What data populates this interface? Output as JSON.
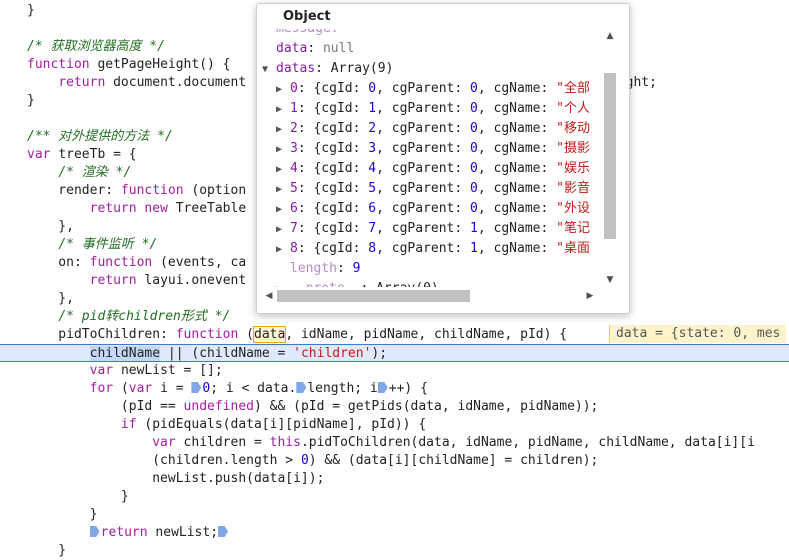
{
  "code_lines": [
    {
      "tokens": [
        {
          "t": "}"
        }
      ]
    },
    {
      "tokens": [
        {
          "t": ""
        }
      ]
    },
    {
      "tokens": [
        {
          "t": "/* 获取浏览器高度 */",
          "c": "c"
        }
      ]
    },
    {
      "tokens": [
        {
          "t": "function ",
          "c": "k"
        },
        {
          "t": "getPageHeight() {"
        }
      ]
    },
    {
      "tokens": [
        {
          "t": "    "
        },
        {
          "t": "return ",
          "c": "k"
        },
        {
          "t": "document.document"
        }
      ]
    },
    {
      "tokens": [
        {
          "t": "}"
        }
      ]
    },
    {
      "tokens": [
        {
          "t": ""
        }
      ]
    },
    {
      "tokens": [
        {
          "t": "/** 对外提供的方法 */",
          "c": "c"
        }
      ]
    },
    {
      "tokens": [
        {
          "t": "var ",
          "c": "k"
        },
        {
          "t": "treeTb = {"
        }
      ]
    },
    {
      "tokens": [
        {
          "t": "    "
        },
        {
          "t": "/* 渲染 */",
          "c": "c"
        }
      ]
    },
    {
      "tokens": [
        {
          "t": "    render: "
        },
        {
          "t": "function ",
          "c": "k"
        },
        {
          "t": "(option"
        }
      ]
    },
    {
      "tokens": [
        {
          "t": "        "
        },
        {
          "t": "return new ",
          "c": "k"
        },
        {
          "t": "TreeTable"
        }
      ]
    },
    {
      "tokens": [
        {
          "t": "    },"
        }
      ]
    },
    {
      "tokens": [
        {
          "t": "    "
        },
        {
          "t": "/* 事件监听 */",
          "c": "c"
        }
      ]
    },
    {
      "tokens": [
        {
          "t": "    on: "
        },
        {
          "t": "function ",
          "c": "k"
        },
        {
          "t": "(events, ca"
        }
      ]
    },
    {
      "tokens": [
        {
          "t": "        "
        },
        {
          "t": "return ",
          "c": "k"
        },
        {
          "t": "layui.onevent"
        }
      ]
    },
    {
      "tokens": [
        {
          "t": "    },"
        }
      ]
    },
    {
      "tokens": [
        {
          "t": "    "
        },
        {
          "t": "/* pid转children形式 */",
          "c": "c"
        }
      ]
    },
    {
      "tokens": [
        {
          "t": "    pidToChildren: "
        },
        {
          "t": "function ",
          "c": "k"
        },
        {
          "t": "("
        },
        {
          "t": "data",
          "c": "hl-box"
        },
        {
          "t": ", idName, pidName, childName, pId) {"
        }
      ]
    },
    {
      "current": true,
      "tokens": [
        {
          "t": "        "
        },
        {
          "t": "childName",
          "c": "hl-sel"
        },
        {
          "t": " || (childName = "
        },
        {
          "t": "'children'",
          "c": "s"
        },
        {
          "t": ");"
        }
      ]
    },
    {
      "tokens": [
        {
          "t": "        "
        },
        {
          "t": "var ",
          "c": "k"
        },
        {
          "t": "newList = [];"
        }
      ]
    },
    {
      "tokens": [
        {
          "t": "        "
        },
        {
          "t": "for ",
          "c": "k"
        },
        {
          "t": "("
        },
        {
          "t": "var ",
          "c": "k"
        },
        {
          "t": "i = "
        },
        {
          "t": "",
          "c": "bp"
        },
        {
          "t": "0",
          "c": "n"
        },
        {
          "t": "; i < data."
        },
        {
          "t": "",
          "c": "bp"
        },
        {
          "t": "length; i"
        },
        {
          "t": "",
          "c": "bp"
        },
        {
          "t": "++) {"
        }
      ]
    },
    {
      "tokens": [
        {
          "t": "            (pId == "
        },
        {
          "t": "undefined",
          "c": "k"
        },
        {
          "t": ") && (pId = getPids(data, idName, pidName));"
        }
      ]
    },
    {
      "tokens": [
        {
          "t": "            "
        },
        {
          "t": "if ",
          "c": "k"
        },
        {
          "t": "(pidEquals(data[i][pidName], pId)) {"
        }
      ]
    },
    {
      "tokens": [
        {
          "t": "                "
        },
        {
          "t": "var ",
          "c": "k"
        },
        {
          "t": "children = "
        },
        {
          "t": "this",
          "c": "k"
        },
        {
          "t": ".pidToChildren(data, idName, pidName, childName, data[i][i"
        }
      ]
    },
    {
      "tokens": [
        {
          "t": "                (children.length > "
        },
        {
          "t": "0",
          "c": "n"
        },
        {
          "t": ") && (data[i][childName] = children);"
        }
      ]
    },
    {
      "tokens": [
        {
          "t": "                newList.push(data[i]);"
        }
      ]
    },
    {
      "tokens": [
        {
          "t": "            }"
        }
      ]
    },
    {
      "tokens": [
        {
          "t": "        }"
        }
      ]
    },
    {
      "tokens": [
        {
          "t": "        "
        },
        {
          "t": "",
          "c": "bp"
        },
        {
          "t": "return ",
          "c": "k"
        },
        {
          "t": "newList;"
        },
        {
          "t": "",
          "c": "bp"
        }
      ]
    },
    {
      "tokens": [
        {
          "t": "    }"
        }
      ]
    }
  ],
  "code_tail": {
    "line4_tail": "eight;"
  },
  "inline_value": "data = {state: 0, mes",
  "popover": {
    "title": "Object",
    "rows": [
      {
        "arrow": "",
        "indent": 0,
        "parts": [
          {
            "t": "message:",
            "c": "key dim"
          }
        ]
      },
      {
        "arrow": "",
        "indent": 0,
        "parts": [
          {
            "t": "data",
            "c": "key"
          },
          {
            "t": ": "
          },
          {
            "t": "null",
            "c": "gray"
          }
        ]
      },
      {
        "arrow": "▼",
        "indent": 0,
        "parts": [
          {
            "t": "datas",
            "c": "key"
          },
          {
            "t": ": Array(9)"
          }
        ]
      },
      {
        "arrow": "▶",
        "indent": 1,
        "parts": [
          {
            "t": "0",
            "c": "key"
          },
          {
            "t": ": {cgId: "
          },
          {
            "t": "0",
            "c": "num"
          },
          {
            "t": ", cgParent: "
          },
          {
            "t": "0",
            "c": "num"
          },
          {
            "t": ", cgName: "
          },
          {
            "t": "\"全部",
            "c": "str"
          }
        ]
      },
      {
        "arrow": "▶",
        "indent": 1,
        "parts": [
          {
            "t": "1",
            "c": "key"
          },
          {
            "t": ": {cgId: "
          },
          {
            "t": "1",
            "c": "num"
          },
          {
            "t": ", cgParent: "
          },
          {
            "t": "0",
            "c": "num"
          },
          {
            "t": ", cgName: "
          },
          {
            "t": "\"个人",
            "c": "str"
          }
        ]
      },
      {
        "arrow": "▶",
        "indent": 1,
        "parts": [
          {
            "t": "2",
            "c": "key"
          },
          {
            "t": ": {cgId: "
          },
          {
            "t": "2",
            "c": "num"
          },
          {
            "t": ", cgParent: "
          },
          {
            "t": "0",
            "c": "num"
          },
          {
            "t": ", cgName: "
          },
          {
            "t": "\"移动",
            "c": "str"
          }
        ]
      },
      {
        "arrow": "▶",
        "indent": 1,
        "parts": [
          {
            "t": "3",
            "c": "key"
          },
          {
            "t": ": {cgId: "
          },
          {
            "t": "3",
            "c": "num"
          },
          {
            "t": ", cgParent: "
          },
          {
            "t": "0",
            "c": "num"
          },
          {
            "t": ", cgName: "
          },
          {
            "t": "\"摄影",
            "c": "str"
          }
        ]
      },
      {
        "arrow": "▶",
        "indent": 1,
        "parts": [
          {
            "t": "4",
            "c": "key"
          },
          {
            "t": ": {cgId: "
          },
          {
            "t": "4",
            "c": "num"
          },
          {
            "t": ", cgParent: "
          },
          {
            "t": "0",
            "c": "num"
          },
          {
            "t": ", cgName: "
          },
          {
            "t": "\"娱乐",
            "c": "str"
          }
        ]
      },
      {
        "arrow": "▶",
        "indent": 1,
        "parts": [
          {
            "t": "5",
            "c": "key"
          },
          {
            "t": ": {cgId: "
          },
          {
            "t": "5",
            "c": "num"
          },
          {
            "t": ", cgParent: "
          },
          {
            "t": "0",
            "c": "num"
          },
          {
            "t": ", cgName: "
          },
          {
            "t": "\"影音",
            "c": "str"
          }
        ]
      },
      {
        "arrow": "▶",
        "indent": 1,
        "parts": [
          {
            "t": "6",
            "c": "key"
          },
          {
            "t": ": {cgId: "
          },
          {
            "t": "6",
            "c": "num"
          },
          {
            "t": ", cgParent: "
          },
          {
            "t": "0",
            "c": "num"
          },
          {
            "t": ", cgName: "
          },
          {
            "t": "\"外设",
            "c": "str"
          }
        ]
      },
      {
        "arrow": "▶",
        "indent": 1,
        "parts": [
          {
            "t": "7",
            "c": "key"
          },
          {
            "t": ": {cgId: "
          },
          {
            "t": "7",
            "c": "num"
          },
          {
            "t": ", cgParent: "
          },
          {
            "t": "1",
            "c": "num"
          },
          {
            "t": ", cgName: "
          },
          {
            "t": "\"笔记",
            "c": "str"
          }
        ]
      },
      {
        "arrow": "▶",
        "indent": 1,
        "parts": [
          {
            "t": "8",
            "c": "key"
          },
          {
            "t": ": {cgId: "
          },
          {
            "t": "8",
            "c": "num"
          },
          {
            "t": ", cgParent: "
          },
          {
            "t": "1",
            "c": "num"
          },
          {
            "t": ", cgName: "
          },
          {
            "t": "\"桌面",
            "c": "str"
          }
        ]
      },
      {
        "arrow": "",
        "indent": 1,
        "parts": [
          {
            "t": "length",
            "c": "key dim"
          },
          {
            "t": ": "
          },
          {
            "t": "9",
            "c": "num"
          }
        ]
      },
      {
        "arrow": "▶",
        "indent": 1,
        "parts": [
          {
            "t": "__proto__",
            "c": "key dim"
          },
          {
            "t": ": Array(0)"
          }
        ]
      }
    ]
  },
  "icons": {
    "scroll_up": "▲",
    "scroll_down": "▼",
    "scroll_left": "◀",
    "scroll_right": "▶"
  }
}
